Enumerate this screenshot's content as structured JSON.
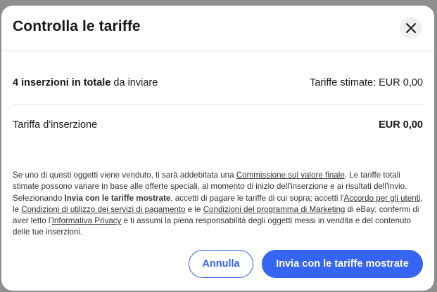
{
  "dialog": {
    "title": "Controlla le tariffe",
    "close_icon": "close-icon"
  },
  "summary": {
    "count_label": "4 inserzioni in totale",
    "count_suffix": " da inviare",
    "estimate_label": "Tariffe stimate: EUR 0,00"
  },
  "fee": {
    "label": "Tariffa d'inserzione",
    "value": "EUR 0,00"
  },
  "legal": {
    "t1": "Se uno di questi oggetti viene venduto, ti sarà addebitata una ",
    "link_fee": "Commissione sul valore finale",
    "t2": ". Le tariffe totali stimate possono variare in base alle offerte speciali, al momento di inizio dell'inserzione e ai risultati dell'invio. Selezionando ",
    "bold_action": "Invia con le tariffe mostrate",
    "t3": ", accetti di pagare le tariffe di cui sopra; accetti l'",
    "link_user_agreement": "Accordo per gli utenti",
    "t4": ", le ",
    "link_payment_terms": "Condizioni di utilizzo dei servizi di pagamento",
    "t5": " e le ",
    "link_marketing_terms": "Condizioni del programma di Marketing",
    "t6": " di eBay; confermi di aver letto l'",
    "link_privacy": "Informativa Privacy",
    "t7": " e ti assumi la piena responsabilità degli oggetti messi in vendita e del contenuto delle tue inserzioni."
  },
  "actions": {
    "cancel_label": "Annulla",
    "submit_label": "Invia con le tariffe mostrate"
  },
  "colors": {
    "accent": "#3665f3",
    "text": "#191919",
    "divider": "#e5e5e5",
    "close_bg": "#f0f0f0"
  }
}
